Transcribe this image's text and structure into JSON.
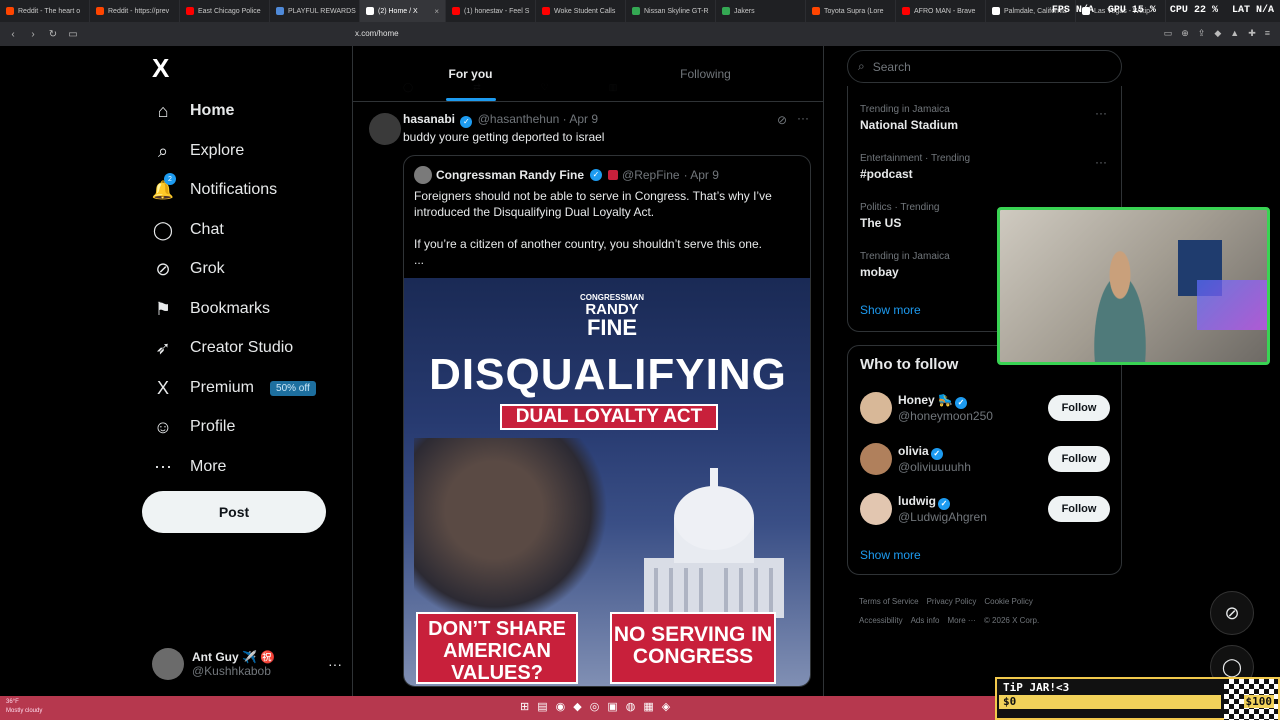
{
  "browser": {
    "tabs": [
      {
        "label": "Reddit - The heart o",
        "color": "#ff4500"
      },
      {
        "label": "Reddit - https://prev",
        "color": "#ff4500"
      },
      {
        "label": "East Chicago Police",
        "color": "#ff0000"
      },
      {
        "label": "PLAYFUL REWARDS",
        "color": "#4f8ad9"
      },
      {
        "label": "(2) Home / X",
        "color": "#ffffff",
        "active": true
      },
      {
        "label": "(1) honestav - Feel S",
        "color": "#ff0000"
      },
      {
        "label": "Woke Student Calls",
        "color": "#ff0000"
      },
      {
        "label": "Nissan Skyline GT-R",
        "color": "#34a853"
      },
      {
        "label": "Jakers",
        "color": "#34a853"
      },
      {
        "label": "Toyota Supra (Lore",
        "color": "#ff4500"
      },
      {
        "label": "AFRO MAN - Brave",
        "color": "#ff0000"
      },
      {
        "label": "Palmdale, California",
        "color": "#ffffff"
      },
      {
        "label": "Las Vegas - Wikip",
        "color": "#ffffff"
      }
    ],
    "url": "x.com/home",
    "perf": {
      "fps_label": "FPS",
      "fps": "N/A",
      "gpu_label": "GPU",
      "gpu": "15 %",
      "cpu_label": "CPU",
      "cpu": "22 %",
      "lat_label": "LAT",
      "lat": "N/A"
    }
  },
  "nav": {
    "logo": "X",
    "items": [
      {
        "label": "Home",
        "icon": "home-icon",
        "glyph": "⌂"
      },
      {
        "label": "Explore",
        "icon": "search-icon",
        "glyph": "⌕"
      },
      {
        "label": "Notifications",
        "icon": "bell-icon",
        "glyph": "🔔",
        "badge": "2"
      },
      {
        "label": "Chat",
        "icon": "chat-icon",
        "glyph": "◯"
      },
      {
        "label": "Grok",
        "icon": "grok-icon",
        "glyph": "⊘"
      },
      {
        "label": "Bookmarks",
        "icon": "bookmark-icon",
        "glyph": "⚑"
      },
      {
        "label": "Creator Studio",
        "icon": "rocket-icon",
        "glyph": "➶"
      },
      {
        "label": "Premium",
        "icon": "x-icon",
        "glyph": "X",
        "pill": "50% off"
      },
      {
        "label": "Profile",
        "icon": "person-icon",
        "glyph": "☺"
      },
      {
        "label": "More",
        "icon": "more-icon",
        "glyph": "⋯"
      }
    ],
    "post_button": "Post",
    "account": {
      "name": "Ant Guy ✈️ ㊗️",
      "handle": "@Kushhkabob"
    }
  },
  "feed": {
    "tabs": [
      "For you",
      "Following"
    ],
    "post": {
      "name": "hasanabi",
      "handle": "@hasanthehun",
      "date": "· Apr 9",
      "text": "buddy youre getting deported to israel",
      "quote": {
        "name": "Congressman Randy Fine",
        "handle": "@RepFine",
        "date": "· Apr 9",
        "text1": "Foreigners should not be able to serve in Congress.  That’s why I’ve introduced the Disqualifying Dual Loyalty Act.",
        "text2": "If you’re a citizen of another country, you shouldn’t serve this one.",
        "text3": "...",
        "poster": {
          "brand_top": "CONGRESSMAN",
          "brand_mid": "RANDY",
          "brand_bot": "FINE",
          "title": "DISQUALIFYING",
          "subtitle": "DUAL LOYALTY ACT",
          "left_box": "DON’T SHARE AMERICAN VALUES?",
          "right_box": "NO SERVING IN CONGRESS"
        }
      }
    }
  },
  "right": {
    "search_placeholder": "Search",
    "trends": [
      {
        "context": "Trending in Jamaica",
        "title": "National Stadium"
      },
      {
        "context": "Entertainment · Trending",
        "title": "#podcast"
      },
      {
        "context": "Politics · Trending",
        "title": "The US"
      },
      {
        "context": "Trending in Jamaica",
        "title": "mobay"
      }
    ],
    "trends_show_more": "Show more",
    "who_to_follow_title": "Who to follow",
    "suggestions": [
      {
        "name": "Honey 🛼",
        "handle": "@honeymoon250",
        "button": "Follow"
      },
      {
        "name": "olivia",
        "handle": "@oliviuuuuhh",
        "button": "Follow"
      },
      {
        "name": "ludwig",
        "handle": "@LudwigAhgren",
        "button": "Follow"
      }
    ],
    "wtf_show_more": "Show more",
    "footer": [
      "Terms of Service",
      "Privacy Policy",
      "Cookie Policy",
      "Accessibility",
      "Ads info",
      "More ···",
      "© 2026 X Corp."
    ]
  },
  "overlay": {
    "tipjar_title": "TiP JAR!<3",
    "tipjar_amount": "$0",
    "tipjar_goal": "$100",
    "tipjar_progress": 0
  },
  "taskbar": {
    "temp": "36°F",
    "weather": "Mostly cloudy"
  },
  "colors": {
    "accent": "#1d9bf0",
    "cam_border": "#39d353",
    "taskbar": "#b6384e"
  }
}
